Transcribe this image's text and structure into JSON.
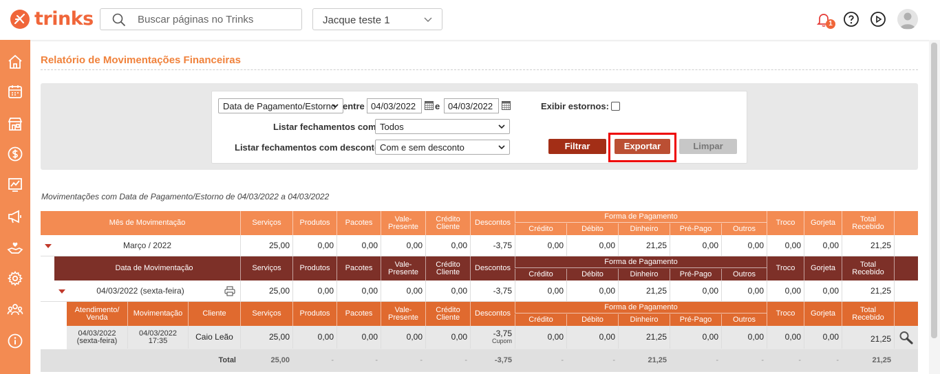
{
  "brand": {
    "logo_text": "trinks"
  },
  "search": {
    "placeholder": "Buscar páginas no Trinks"
  },
  "establishment": {
    "selected": "Jacque teste 1"
  },
  "notifications": {
    "count": "1"
  },
  "sidebar": [
    {
      "icon": "home-icon"
    },
    {
      "icon": "agenda-icon"
    },
    {
      "icon": "store-icon"
    },
    {
      "icon": "dollar-icon"
    },
    {
      "icon": "chart-icon"
    },
    {
      "icon": "megaphone-icon"
    },
    {
      "icon": "hand-heart-icon"
    },
    {
      "icon": "gear-icon"
    },
    {
      "icon": "people-icon"
    },
    {
      "icon": "info-icon"
    }
  ],
  "page": {
    "title": "Relatório de Movimentações Financeiras"
  },
  "filters": {
    "date_type": "Data de Pagamento/Estorno",
    "between_label": "entre",
    "date_from": "04/03/2022",
    "and_label": "e",
    "date_to": "04/03/2022",
    "show_reversals_label": "Exibir estornos:",
    "closings_label": "Listar fechamentos com:",
    "closings_value": "Todos",
    "discount_label": "Listar fechamentos com desconto:",
    "discount_value": "Com e sem desconto",
    "filter_btn": "Filtrar",
    "export_btn": "Exportar",
    "clear_btn": "Limpar"
  },
  "results_caption": "Movimentações com Data de Pagamento/Estorno de 04/03/2022 a 04/03/2022",
  "colors": {
    "accent": "#f0663a",
    "header1": "#f38b52",
    "header2": "#7d3028",
    "header3": "#e06a2f"
  },
  "table": {
    "h1_first": "Mês de Movimentação",
    "h2_first": "Data de Movimentação",
    "h3_first": [
      "Atendimento/ Venda",
      "Movimentação",
      "Cliente"
    ],
    "cols": [
      "Serviços",
      "Produtos",
      "Pacotes",
      "Vale-Presente",
      "Crédito Cliente",
      "Descontos"
    ],
    "forma_pagamento": "Forma de Pagamento",
    "forma_cols": [
      "Crédito",
      "Débito",
      "Dinheiro",
      "Pré-Pago",
      "Outros"
    ],
    "tail_cols": [
      "Troco",
      "Gorjeta",
      "Total Recebido"
    ],
    "month_row": {
      "label": "Março / 2022",
      "values": [
        "25,00",
        "0,00",
        "0,00",
        "0,00",
        "0,00",
        "-3,75",
        "0,00",
        "0,00",
        "21,25",
        "0,00",
        "0,00",
        "0,00",
        "0,00",
        "21,25"
      ]
    },
    "day_row": {
      "label": "04/03/2022 (sexta-feira)",
      "values": [
        "25,00",
        "0,00",
        "0,00",
        "0,00",
        "0,00",
        "-3,75",
        "0,00",
        "0,00",
        "21,25",
        "0,00",
        "0,00",
        "0,00",
        "0,00",
        "21,25"
      ]
    },
    "detail_row": {
      "atendimento": [
        "04/03/2022",
        "(sexta-feira)"
      ],
      "movimentacao": [
        "04/03/2022",
        "17:35"
      ],
      "cliente": "Caio Leão",
      "values": [
        "25,00",
        "0,00",
        "0,00",
        "0,00",
        "0,00",
        "-3,75",
        "0,00",
        "0,00",
        "21,25",
        "0,00",
        "0,00",
        "0,00",
        "0,00",
        "21,25"
      ],
      "discount_note": "Cupom"
    },
    "total_row": {
      "label": "Total",
      "values": [
        "25,00",
        "-",
        "-",
        "-",
        "-",
        "-3,75",
        "-",
        "-",
        "21,25",
        "-",
        "-",
        "-",
        "-",
        "21,25"
      ]
    }
  }
}
